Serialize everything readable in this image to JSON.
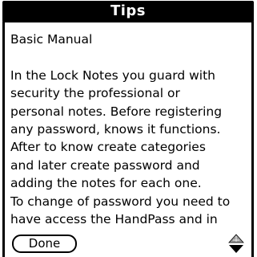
{
  "window": {
    "title": "Tips"
  },
  "content": {
    "lines": [
      "Basic Manual",
      "",
      "In the Lock Notes you guard with",
      "security the professional or",
      "personal notes. Before registering",
      "any password, knows  it functions.",
      "After to know create categories",
      "and later create password and",
      "adding the notes for each one.",
      "To change of password you need to",
      "have access the HandPass and in"
    ]
  },
  "buttons": {
    "done_label": "Done"
  },
  "scroll": {
    "up_icon": "scroll-up-arrow-icon",
    "down_icon": "scroll-down-arrow-icon",
    "up_state": "dimmed",
    "down_state": "active"
  }
}
